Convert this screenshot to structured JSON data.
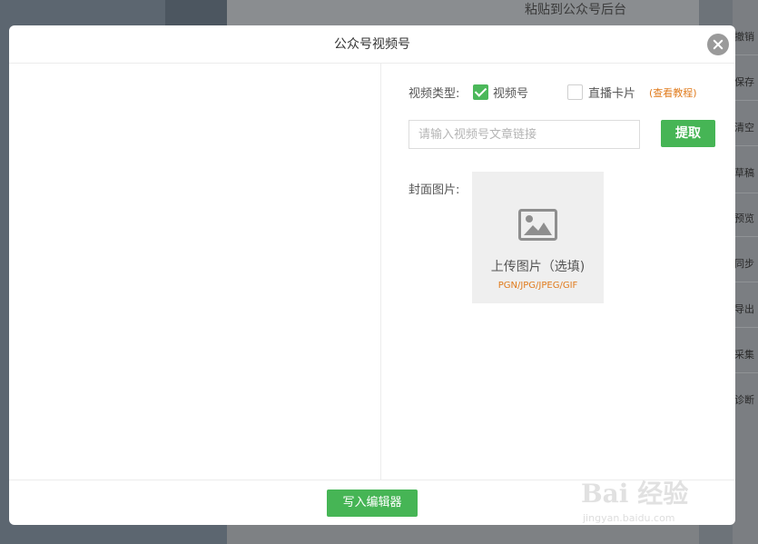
{
  "background": {
    "top_text": "粘贴到公众号后台",
    "side_items": [
      "撤销",
      "保存",
      "清空",
      "草稿",
      "预览",
      "同步",
      "导出",
      "采集",
      "诊断"
    ]
  },
  "modal": {
    "title": "公众号视频号",
    "type_label": "视频类型:",
    "options": [
      {
        "label": "视频号",
        "checked": true
      },
      {
        "label": "直播卡片",
        "checked": false
      }
    ],
    "tutorial_link": "(查看教程)",
    "url_input": {
      "placeholder": "请输入视频号文章链接",
      "value": ""
    },
    "fetch_button": "提取",
    "cover_label": "封面图片:",
    "upload": {
      "icon": "image-icon",
      "text": "上传图片（选填)",
      "formats": "PGN/JPG/JPEG/GIF"
    },
    "write_button": "写入编辑器"
  },
  "watermark": {
    "main": "Bai 经验",
    "sub": "jingyan.baidu.com"
  },
  "colors": {
    "accent_green": "#46b555",
    "link_orange": "#e07b1d",
    "close_gray": "#9a9a9a"
  }
}
